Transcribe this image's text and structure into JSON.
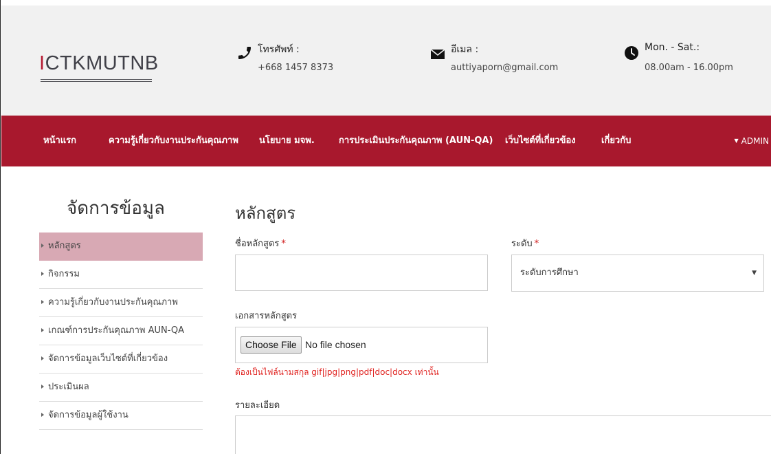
{
  "header": {
    "logo": {
      "accent": "I",
      "rest": "CTKMUTNB"
    },
    "contacts": {
      "phone": {
        "icon": "phone-icon",
        "label": "โทรศัพท์ :",
        "value": "+668 1457 8373"
      },
      "email": {
        "icon": "envelope-icon",
        "label": "อีเมล :",
        "value": "auttiyaporn@gmail.com"
      },
      "hours": {
        "icon": "clock-icon",
        "label": "Mon. - Sat.:",
        "value": "08.00am - 16.00pm"
      }
    }
  },
  "nav": {
    "items": [
      "หน้าแรก",
      "ความรู้เกี่ยวกับงานประกันคุณภาพ",
      "นโยบาย มจพ.",
      "การประเมินประกันคุณภาพ (AUN-QA)",
      "เว็บไซต์ที่เกี่ยวข้อง",
      "เกี่ยวกับ"
    ],
    "admin": "ADMIN"
  },
  "sidebar": {
    "title": "จัดการข้อมูล",
    "items": [
      "หลักสูตร",
      "กิจกรรม",
      "ความรู้เกี่ยวกับงานประกันคุณภาพ",
      "เกณฑ์การประกันคุณภาพ AUN-QA",
      "จัดการข้อมูลเว็บไซต์ที่เกี่ยวข้อง",
      "ประเมินผล",
      "จัดการข้อมูลผู้ใช้งาน"
    ],
    "active_index": 0
  },
  "form": {
    "title": "หลักสูตร",
    "name_label": "ชื่อหลักสูตร",
    "name_value": "",
    "required_mark": "*",
    "level_label": "ระดับ",
    "level_selected": "ระดับการศึกษา",
    "doc_label": "เอกสารหลักสูตร",
    "file_button": "Choose File",
    "file_status": "No file chosen",
    "file_hint": "ต้องเป็นไฟล์นามสกุล gif|jpg|png|pdf|doc|docx เท่านั้น",
    "detail_label": "รายละเอียด",
    "detail_value": ""
  },
  "colors": {
    "brand": "#a8182d",
    "active_item": "#d8a9b4",
    "hint": "#e0221f"
  }
}
